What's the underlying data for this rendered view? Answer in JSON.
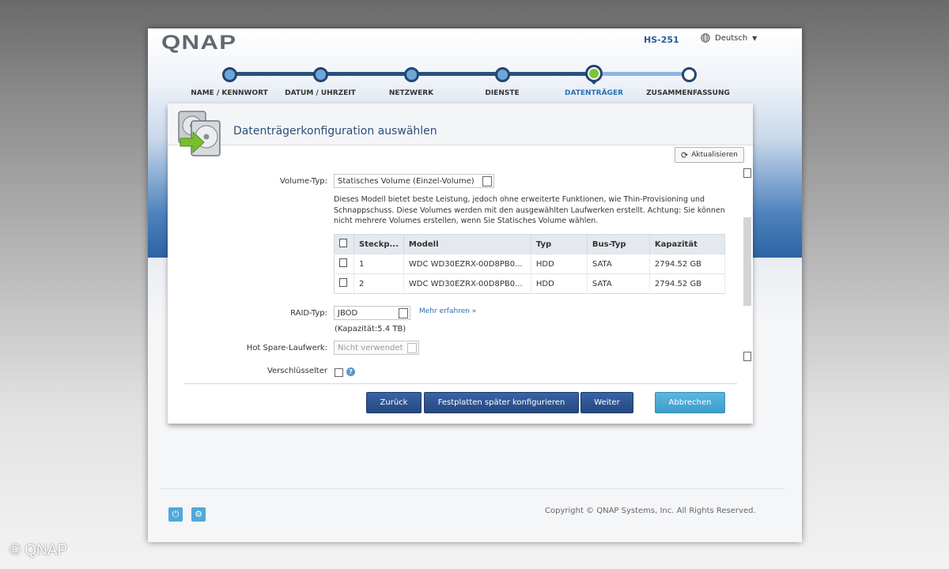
{
  "header": {
    "logo": "QNAP",
    "model": "HS-251",
    "language": "Deutsch"
  },
  "wizard": {
    "steps": [
      {
        "label": "NAME / KENNWORT",
        "state": "done"
      },
      {
        "label": "DATUM / UHRZEIT",
        "state": "done"
      },
      {
        "label": "NETZWERK",
        "state": "done"
      },
      {
        "label": "DIENSTE",
        "state": "done"
      },
      {
        "label": "DATENTRÄGER",
        "state": "active"
      },
      {
        "label": "ZUSAMMENFASSUNG",
        "state": "future"
      }
    ]
  },
  "panel": {
    "title": "Datenträgerkonfiguration auswählen",
    "refresh_label": "Aktualisieren",
    "volume_type_label": "Volume-Typ:",
    "volume_type_value": "Statisches Volume (Einzel-Volume)",
    "description": "Dieses Modell bietet beste Leistung, jedoch ohne erweiterte Funktionen, wie Thin-Provisioning und Schnappschuss. Diese Volumes werden mit den ausgewählten Laufwerken erstellt. Achtung: Sie können nicht mehrere Volumes erstellen, wenn Sie Statisches Volume wählen.",
    "table": {
      "columns": [
        "Steckp...",
        "Modell",
        "Typ",
        "Bus-Typ",
        "Kapazität"
      ],
      "rows": [
        {
          "slot": "1",
          "model": "WDC WD30EZRX-00D8PB0...",
          "type": "HDD",
          "bus": "SATA",
          "capacity": "2794.52 GB"
        },
        {
          "slot": "2",
          "model": "WDC WD30EZRX-00D8PB0...",
          "type": "HDD",
          "bus": "SATA",
          "capacity": "2794.52 GB"
        }
      ]
    },
    "raid_label": "RAID-Typ:",
    "raid_value": "JBOD",
    "more_link": "Mehr erfahren »",
    "capacity_text": "(Kapazität:5.4 TB)",
    "hotspare_label": "Hot Spare-Laufwerk:",
    "hotspare_value": "Nicht verwendet",
    "encrypted_label": "Verschlüsselter",
    "buttons": {
      "back": "Zurück",
      "later": "Festplatten später konfigurieren",
      "next": "Weiter",
      "cancel": "Abbrechen"
    }
  },
  "footer": {
    "copyright": "Copyright © QNAP Systems, Inc. All Rights Reserved."
  },
  "watermark": "© QNAP",
  "colors": {
    "accent": "#2b6fb4",
    "button_dark": "#2d5593",
    "button_light": "#4aa9d6",
    "active_step": "#7cc338"
  }
}
